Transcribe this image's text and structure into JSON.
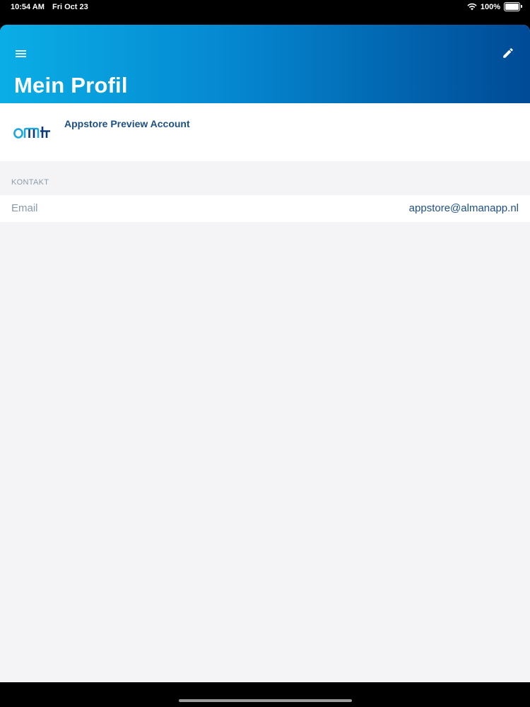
{
  "status_bar": {
    "time": "10:54 AM",
    "date": "Fri Oct 23",
    "battery": "100%",
    "battery_level": 1.0,
    "icons": [
      "wifi-icon",
      "battery-icon"
    ]
  },
  "header": {
    "title": "Mein Profil",
    "menu_icon": "menu-icon",
    "edit_icon": "edit-pencil-icon",
    "gradient": [
      "#0aaee6",
      "#004a96"
    ]
  },
  "profile": {
    "logo_text": "omt",
    "account_name": "Appstore Preview Account"
  },
  "sections": [
    {
      "title": "KONTAKT",
      "rows": [
        {
          "label": "Email",
          "value": "appstore@almanapp.nl"
        }
      ]
    }
  ],
  "colors": {
    "accent_text": "#1d4f86",
    "secondary_text": "#8a9aab",
    "background": "#f4f4f6",
    "logo_light": "#1ea7dc",
    "logo_dark": "#0c3a78"
  }
}
